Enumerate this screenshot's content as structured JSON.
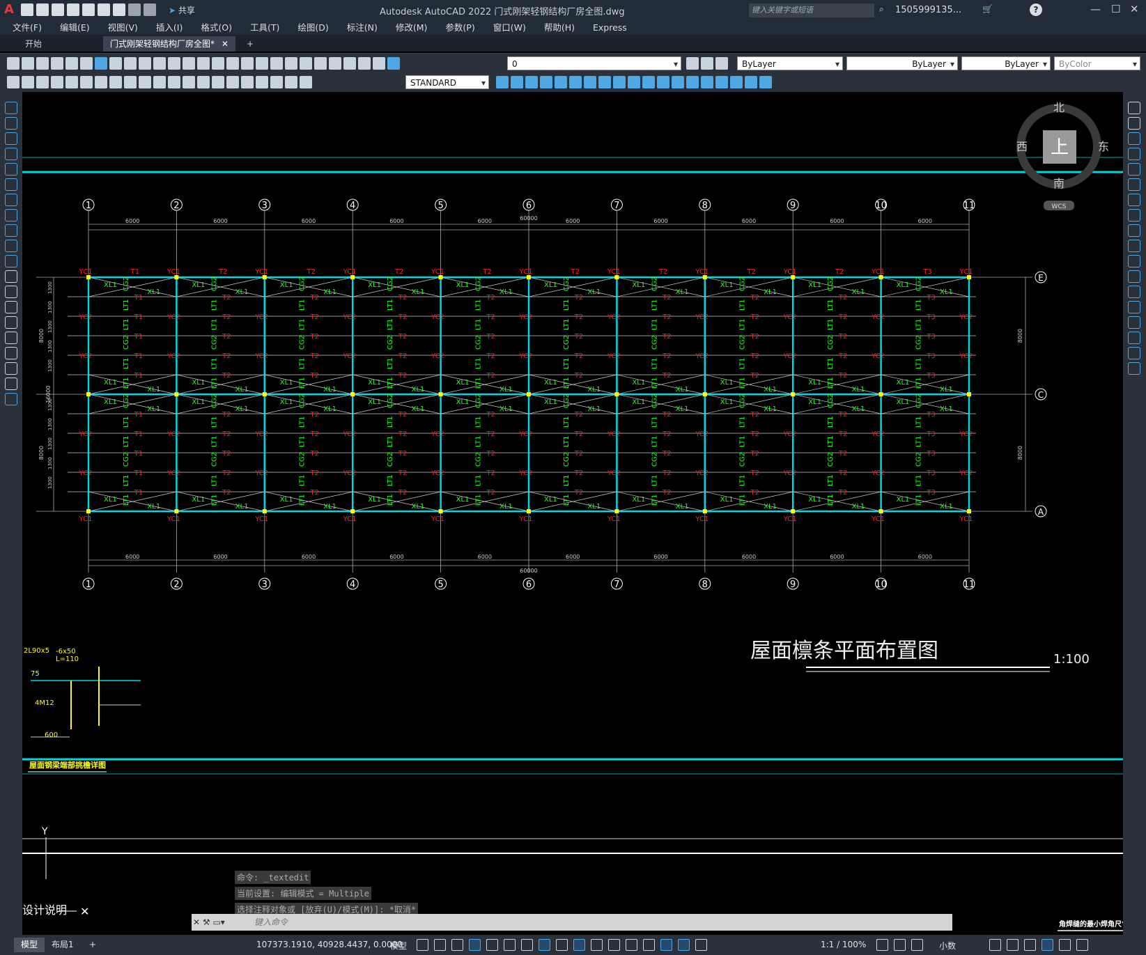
{
  "app": {
    "title": "Autodesk AutoCAD 2022    门式刚架轻钢结构厂房全图.dwg",
    "search_placeholder": "键入关键字或短语",
    "user": "1505999135..."
  },
  "share_label": "共享",
  "menu": [
    "文件(F)",
    "编辑(E)",
    "视图(V)",
    "插入(I)",
    "格式(O)",
    "工具(T)",
    "绘图(D)",
    "标注(N)",
    "修改(M)",
    "参数(P)",
    "窗口(W)",
    "帮助(H)",
    "Express"
  ],
  "tabs": [
    {
      "label": "开始"
    },
    {
      "label": "门式刚架轻钢结构厂房全图*"
    }
  ],
  "toolbar": {
    "layer": "0",
    "color": "ByLayer",
    "linetype": "ByLayer",
    "lineweight": "ByLayer",
    "plotstyle": "ByColor",
    "textstyle": "STANDARD"
  },
  "viewcube": {
    "north": "北",
    "south": "南",
    "east": "东",
    "west": "西",
    "face": "上",
    "wcs": "WCS"
  },
  "drawing": {
    "axes_num": [
      "1",
      "2",
      "3",
      "4",
      "5",
      "6",
      "7",
      "8",
      "9",
      "10",
      "11"
    ],
    "axes_letter": [
      "E",
      "C",
      "A"
    ],
    "span": "6000",
    "total": "60000",
    "side_dims": [
      "1300",
      "8000",
      "16000"
    ],
    "title": "屋面檩条平面布置图",
    "scale": "1:100",
    "labels": {
      "yc1": "YC1",
      "yc2": "YC2",
      "t1": "T1",
      "t2": "T2",
      "t3": "T3",
      "xl": "XL1",
      "lt": "LT1",
      "cg": "CG2"
    },
    "detail": {
      "title": "屋面钢梁端部挑檐详图",
      "a": "2L90x5",
      "b": "-6x50",
      "c": "L=110",
      "d": "75",
      "e": "4M12",
      "f": "600"
    },
    "bottom_text": "设计说明",
    "right_note": "角焊缝的最小焊角尺寸",
    "axis_y": "Y"
  },
  "command": {
    "history": [
      "命令: _textedit",
      "当前设置: 编辑模式 = Multiple",
      "选择注释对象或 [放弃(U)/模式(M)]: *取消*"
    ],
    "placeholder": "键入命令"
  },
  "status": {
    "tabs": [
      "模型",
      "布局1"
    ],
    "coords": "107373.1910, 40928.4437, 0.0000",
    "model": "模型",
    "scale": "1:1 / 100%",
    "units": "小数"
  },
  "colors": {
    "cyan": "#00d8e0",
    "red": "#ff2020",
    "green": "#20ff20",
    "grid": "#aaaaaa",
    "yellow": "#ffff00"
  }
}
